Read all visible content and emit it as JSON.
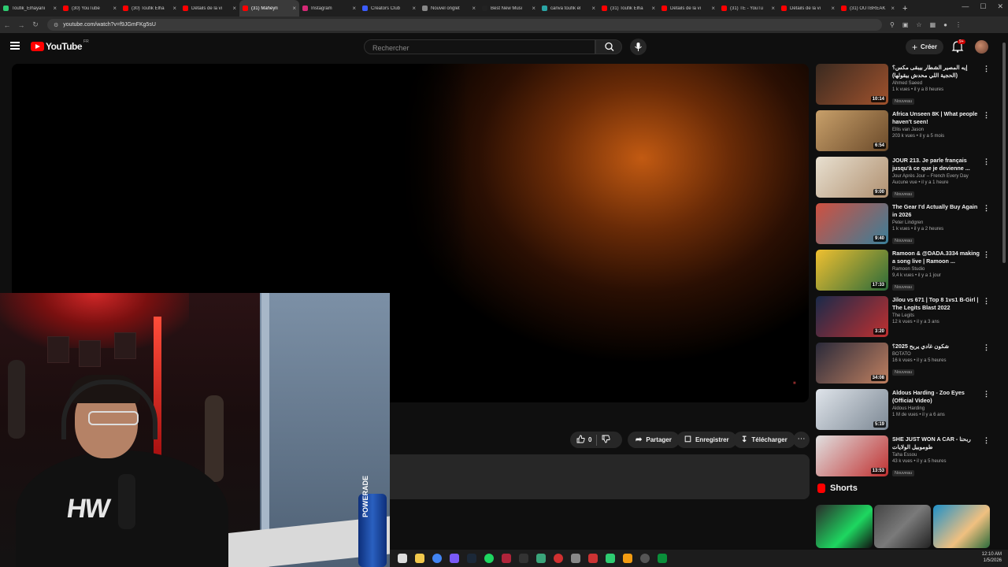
{
  "browser": {
    "tabs": [
      {
        "label": "Toufik_Elhayani",
        "color": "#2ecc71",
        "active": false
      },
      {
        "label": "(30) YouTube",
        "color": "#ff0000",
        "active": false
      },
      {
        "label": "(30) Toufik Elha",
        "color": "#ff0000",
        "active": false
      },
      {
        "label": "Détails de la vi",
        "color": "#ff0000",
        "active": false
      },
      {
        "label": "(31) Maheyri",
        "color": "#ff0000",
        "active": true
      },
      {
        "label": "Instagram",
        "color": "#d62976",
        "active": false
      },
      {
        "label": "Creators Club",
        "color": "#3b5cff",
        "active": false
      },
      {
        "label": "Nouvel onglet",
        "color": "#888888",
        "active": false
      },
      {
        "label": "Best New Musi",
        "color": "#222222",
        "active": false
      },
      {
        "label": "canva toufik el",
        "color": "#2aa5a5",
        "active": false
      },
      {
        "label": "(31) Toufik Elha",
        "color": "#ff0000",
        "active": false
      },
      {
        "label": "Détails de la vi",
        "color": "#ff0000",
        "active": false
      },
      {
        "label": "(31) TE - YouTu",
        "color": "#ff0000",
        "active": false
      },
      {
        "label": "Détails de la vi",
        "color": "#ff0000",
        "active": false
      },
      {
        "label": "(31) OUTBREAK",
        "color": "#ff0000",
        "active": false
      }
    ],
    "url": "youtube.com/watch?v=f9JGmFKg5sU"
  },
  "youtube": {
    "logo_text": "YouTube",
    "country_code": "FR",
    "search_placeholder": "Rechercher",
    "create_label": "Créer",
    "notif_count": "9+"
  },
  "actions": {
    "like_count": "0",
    "share_label": "Partager",
    "save_label": "Enregistrer",
    "download_label": "Télécharger"
  },
  "webcam": {
    "shirt_text": "HW",
    "bottle_text": "POWERADE"
  },
  "sidebar": {
    "videos": [
      {
        "title": "إيه المصير الشطار بيبقى مكس؟ (الحجية اللي محدش بيقولها)",
        "channel": "Ahmed Saeed",
        "meta": "1 k vues • il y a 8 heures",
        "duration": "10:14",
        "new": true,
        "thumb": [
          "#3a2a20",
          "#a0522d"
        ]
      },
      {
        "title": "Africa Unseen 8K | What people haven't seen!",
        "channel": "Ellis van Jason",
        "meta": "203 k vues • il y a 5 mois",
        "duration": "6:54",
        "new": false,
        "thumb": [
          "#c8a06a",
          "#6b4a2a"
        ]
      },
      {
        "title": "JOUR 213. Je parle français jusqu'à ce que je devienne ...",
        "channel": "Jour Après Jour – French Every Day",
        "meta": "Aucune vue • il y a 1 heure",
        "duration": "9:00",
        "new": true,
        "thumb": [
          "#e8e0d0",
          "#b09070"
        ]
      },
      {
        "title": "The Gear I'd Actually Buy Again in 2026",
        "channel": "Peter Lindgren",
        "meta": "1 k vues • il y a 2 heures",
        "duration": "9:40",
        "new": true,
        "thumb": [
          "#d05040",
          "#3a7f9a"
        ]
      },
      {
        "title": "Ramoon & @DADA.3334 making a song live | Ramoon ...",
        "channel": "Ramoon Studio",
        "meta": "9,4 k vues • il y a 1 jour",
        "duration": "17:33",
        "new": true,
        "thumb": [
          "#f0c030",
          "#2a6a3a"
        ]
      },
      {
        "title": "Jilou vs 671 | Top 8 1vs1 B-Girl | The Legits Blast 2022",
        "channel": "The Legits",
        "meta": "12 k vues • il y a 3 ans",
        "duration": "3:20",
        "new": false,
        "thumb": [
          "#1a2a4a",
          "#c03030"
        ]
      },
      {
        "title": "شكون غادي يربح 2025؟",
        "channel": "BOTATO",
        "meta": "16 k vues • il y a 5 heures",
        "duration": "34:08",
        "new": true,
        "thumb": [
          "#2a2a3a",
          "#c08060"
        ]
      },
      {
        "title": "Aldous Harding - Zoo Eyes (Official Video)",
        "channel": "Aldous Harding",
        "meta": "1 M de vues • il y a 6 ans",
        "duration": "5:19",
        "new": false,
        "thumb": [
          "#dfe4ea",
          "#7c8894"
        ]
      },
      {
        "title": "SHE JUST WON A CAR - ربحنا طوموبيل الولايات",
        "channel": "Taha Essou",
        "meta": "43 k vues • il y a 5 heures",
        "duration": "13:53",
        "new": true,
        "thumb": [
          "#e0e0e0",
          "#c03030"
        ]
      }
    ],
    "new_label": "Nouveau",
    "shorts_label": "Shorts"
  },
  "system": {
    "time": "12:10 AM",
    "date": "1/5/2026"
  }
}
